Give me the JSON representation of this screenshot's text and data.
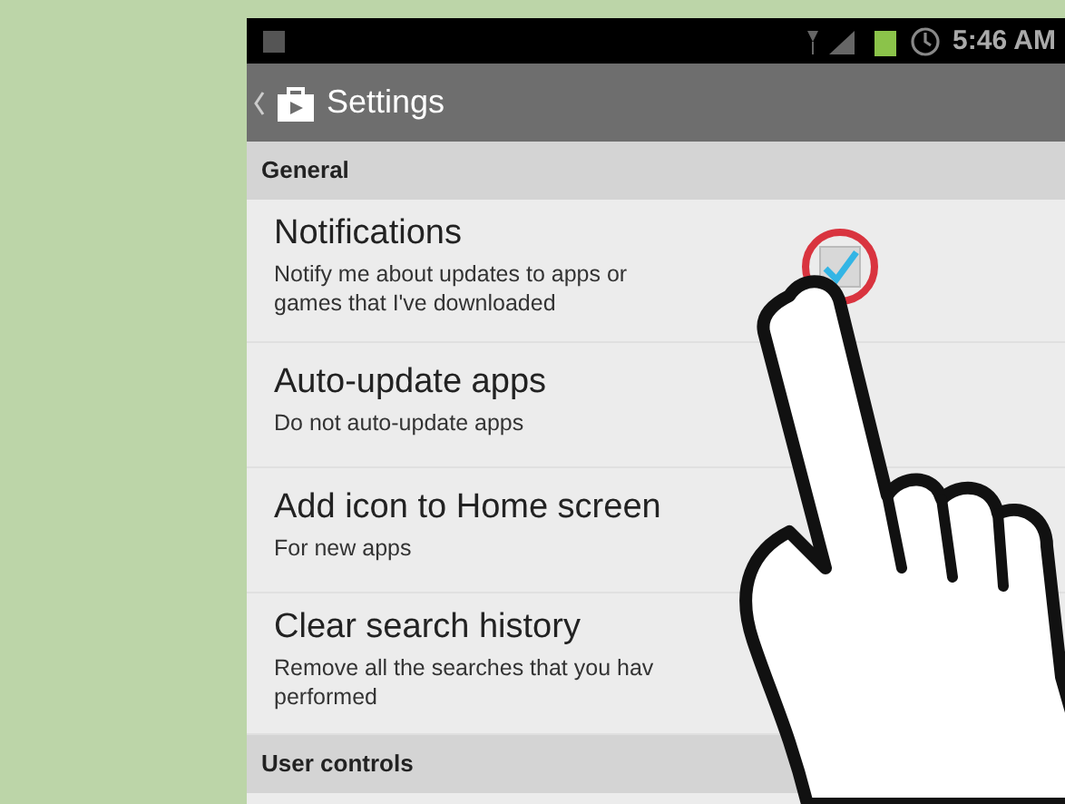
{
  "status_bar": {
    "time": "5:46 AM"
  },
  "action_bar": {
    "title": "Settings"
  },
  "sections": [
    {
      "header": "General",
      "items": [
        {
          "kind": "checkbox",
          "title": "Notifications",
          "description": [
            "Notify me about updates to apps or",
            "games that I've downloaded"
          ],
          "checked": true
        },
        {
          "kind": "plain",
          "title": "Auto-update apps",
          "description": [
            "Do not auto-update apps"
          ]
        },
        {
          "kind": "plain",
          "title": "Add icon to Home screen",
          "description": [
            "For new apps"
          ]
        },
        {
          "kind": "plain",
          "title": "Clear search history",
          "description": [
            "Remove all the searches that you hav",
            "performed"
          ]
        }
      ]
    },
    {
      "header": "User controls"
    }
  ]
}
